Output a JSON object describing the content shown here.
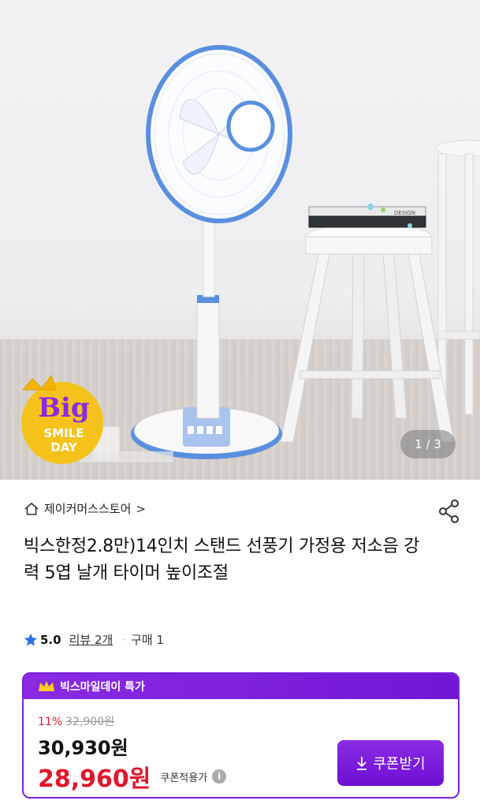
{
  "image": {
    "counter": "1 / 3",
    "badge": {
      "line1": "Big",
      "line2": "SMILE",
      "line3": "DAY"
    },
    "book_text": "DESIGN"
  },
  "store": {
    "name": "제이커머스스토어",
    "chevron": ">"
  },
  "product": {
    "title": "빅스한정2.8만)14인치 스탠드 선풍기 가정용 저소음 강력 5엽 날개 타이머 높이조절"
  },
  "rating": {
    "score": "5.0",
    "review_label": "리뷰 2개",
    "purchase_label": "구매 1"
  },
  "price": {
    "banner": "빅스마일데이 특가",
    "discount": "11%",
    "original": "32,900원",
    "sale": "30,930원",
    "coupon_price": "28,960원",
    "coupon_price_label": "쿠폰적용가",
    "info_symbol": "i",
    "coupon_button": "쿠폰받기"
  },
  "colors": {
    "accent_purple": "#7a20e0",
    "price_red": "#e0162b",
    "fan_blue": "#5a8fe0",
    "star_blue": "#2a6fe8"
  },
  "icons": {
    "home": "home-icon",
    "share": "share-icon",
    "star": "star-icon",
    "crown": "crown-icon",
    "download": "download-arrow-icon"
  }
}
